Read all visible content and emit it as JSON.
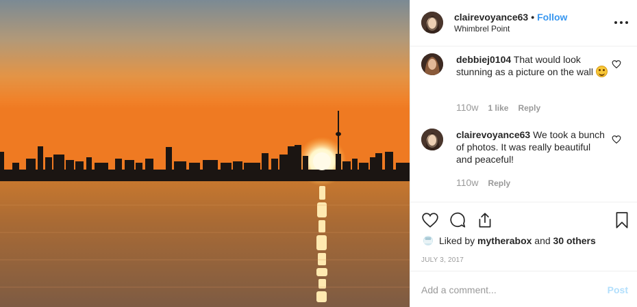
{
  "post": {
    "username": "clairevoyance63",
    "separator": "•",
    "follow_label": "Follow",
    "location": "Whimbrel Point",
    "more_icon": "more-horizontal-icon",
    "photo_icon": "sunset-skyline-photo"
  },
  "comments": [
    {
      "username": "debbiej0104",
      "text": "That would look stunning as a picture on the wall",
      "emoji": "smiling-face-emoji",
      "age": "110w",
      "likes": "1 like",
      "reply_label": "Reply"
    },
    {
      "username": "clairevoyance63",
      "text": "We took a bunch of photos. It was really beautiful and peaceful!",
      "age": "110w",
      "reply_label": "Reply"
    }
  ],
  "actions": {
    "like_icon": "heart-icon",
    "comment_icon": "comment-icon",
    "share_icon": "share-icon",
    "save_icon": "bookmark-icon"
  },
  "likes": {
    "prefix": "Liked by",
    "user": "mytherabox",
    "conj": "and",
    "others": "30 others"
  },
  "date": "JULY 3, 2017",
  "add_comment": {
    "placeholder": "Add a comment...",
    "post_label": "Post"
  },
  "colors": {
    "accent": "#3897f0",
    "post_disabled": "#b2dffc",
    "muted": "#999999",
    "text": "#262626"
  }
}
